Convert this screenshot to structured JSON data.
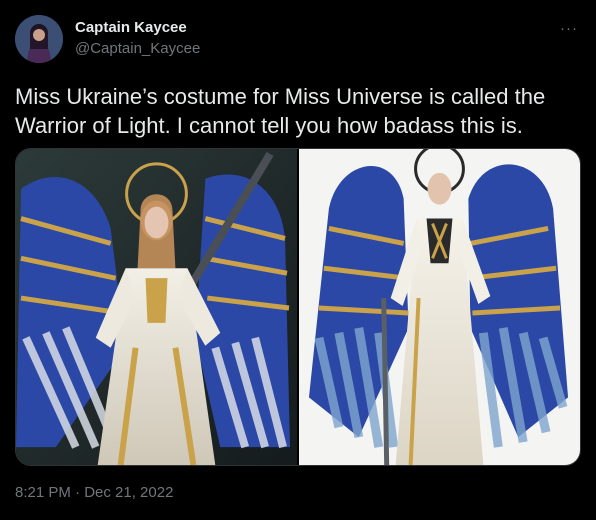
{
  "author": {
    "display_name": "Captain Kaycee",
    "handle": "@Captain_Kaycee"
  },
  "menu": {
    "more_icon": "more-horizontal-icon",
    "more_glyph": "···"
  },
  "tweet": {
    "text": "Miss Ukraine’s costume for Miss Universe is called the Warrior of Light. I cannot tell you how badass this is.",
    "timestamp": "8:21 PM · Dec 21, 2022"
  },
  "colors": {
    "background": "#000000",
    "text_primary": "#e7e9ea",
    "text_secondary": "#71767b",
    "wing_blue": "#2b48a6",
    "gold": "#c9a24a"
  }
}
